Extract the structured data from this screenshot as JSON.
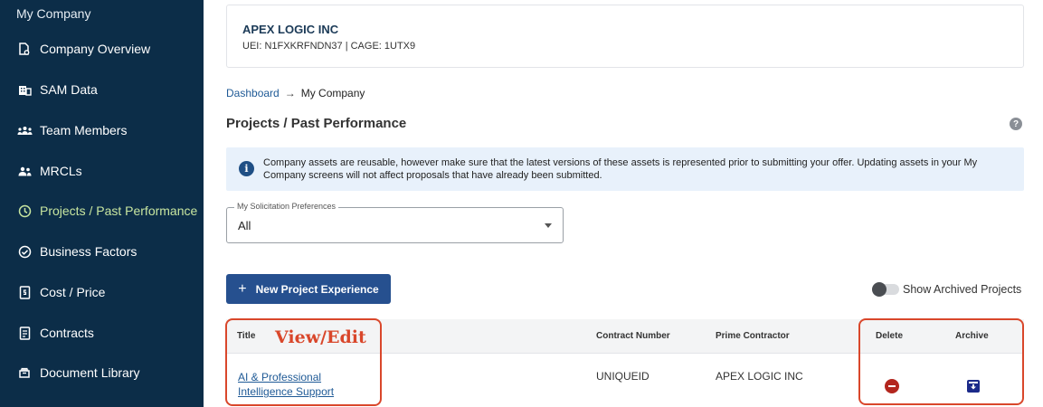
{
  "sidebar": {
    "header": "My Company",
    "items": [
      {
        "label": "Company Overview",
        "icon": "document-gear-icon"
      },
      {
        "label": "SAM Data",
        "icon": "building-icon"
      },
      {
        "label": "Team Members",
        "icon": "team-icon"
      },
      {
        "label": "MRCLs",
        "icon": "people-icon"
      },
      {
        "label": "Projects / Past Performance",
        "icon": "history-icon",
        "active": true
      },
      {
        "label": "Business Factors",
        "icon": "check-circle-icon"
      },
      {
        "label": "Cost / Price",
        "icon": "dollar-document-icon"
      },
      {
        "label": "Contracts",
        "icon": "contract-icon"
      },
      {
        "label": "Document Library",
        "icon": "library-icon"
      }
    ]
  },
  "company": {
    "name": "APEX LOGIC INC",
    "ids": "UEI: N1FXKRFNDN37  |  CAGE: 1UTX9"
  },
  "breadcrumb": {
    "link": "Dashboard",
    "arrow": "→",
    "current": "My Company"
  },
  "page": {
    "title": "Projects / Past Performance",
    "help": "?"
  },
  "info": {
    "icon_text": "i",
    "text": "Company assets are reusable, however make sure that the latest versions of these assets is represented prior to submitting your offer. Updating assets in your My Company screens will not affect proposals that have already been submitted."
  },
  "preferences": {
    "legend": "My Solicitation Preferences",
    "value": "All"
  },
  "new_button": {
    "plus": "+",
    "label": "New Project Experience"
  },
  "archive_toggle": {
    "label": "Show Archived Projects",
    "on": false
  },
  "table": {
    "headers": {
      "title": "Title",
      "contract_number": "Contract Number",
      "prime_contractor": "Prime Contractor",
      "delete": "Delete",
      "archive": "Archive"
    },
    "rows": [
      {
        "title": "AI & Professional Intelligence Support",
        "contract_number": "UNIQUEID",
        "prime_contractor": "APEX LOGIC INC"
      }
    ]
  },
  "annotation": {
    "label": "View/Edit",
    "color": "#d9472b"
  },
  "colors": {
    "sidebar_bg": "#0c2d48",
    "active_item": "#c8e6a0",
    "primary_button": "#26508f",
    "delete_red": "#b3261e",
    "archive_navy": "#1b2a8a",
    "info_bg": "#e8f1fb"
  }
}
